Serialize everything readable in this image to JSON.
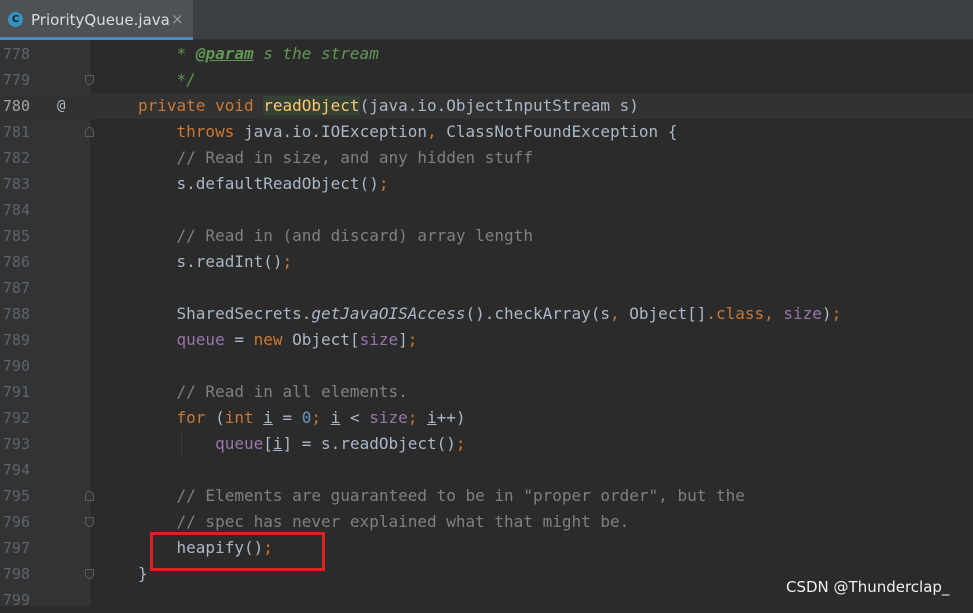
{
  "tab": {
    "label": "PriorityQueue.java",
    "icon": "java-class-icon",
    "close": "×",
    "icon_glyph": "C"
  },
  "gutter": {
    "override_marker": "@"
  },
  "lines": [
    {
      "n": "778",
      "parts": [
        [
          "    ",
          ""
        ],
        [
          "* ",
          "doc"
        ],
        [
          "@param",
          "doctag"
        ],
        [
          " s the stream",
          "doc"
        ]
      ]
    },
    {
      "n": "779",
      "parts": [
        [
          "    ",
          ""
        ],
        [
          "*/",
          "doc"
        ]
      ]
    },
    {
      "n": "780",
      "parts": [
        [
          "private void ",
          "kw"
        ],
        [
          "readObject",
          "fn mhl"
        ],
        [
          "(java.io.ObjectInputStream s)",
          ""
        ]
      ]
    },
    {
      "n": "781",
      "parts": [
        [
          "    ",
          ""
        ],
        [
          "throws ",
          "kw"
        ],
        [
          "java.io.IOException",
          ""
        ],
        [
          ", ",
          "kw"
        ],
        [
          "ClassNotFoundException {",
          ""
        ]
      ]
    },
    {
      "n": "782",
      "parts": [
        [
          "    ",
          ""
        ],
        [
          "// Read in size, and any hidden stuff",
          "cm"
        ]
      ]
    },
    {
      "n": "783",
      "parts": [
        [
          "    s.defaultReadObject()",
          ""
        ],
        [
          ";",
          "kw"
        ]
      ]
    },
    {
      "n": "784",
      "parts": []
    },
    {
      "n": "785",
      "parts": [
        [
          "    ",
          ""
        ],
        [
          "// Read in (and discard) array length",
          "cm"
        ]
      ]
    },
    {
      "n": "786",
      "parts": [
        [
          "    s.readInt()",
          ""
        ],
        [
          ";",
          "kw"
        ]
      ]
    },
    {
      "n": "787",
      "parts": []
    },
    {
      "n": "788",
      "parts": [
        [
          "    SharedSecrets.",
          ""
        ],
        [
          "getJavaOISAccess",
          "it"
        ],
        [
          "().checkArray(s",
          ""
        ],
        [
          ", ",
          "kw"
        ],
        [
          "Object[]",
          ""
        ],
        [
          ".class",
          "kw"
        ],
        [
          ", ",
          "kw"
        ],
        [
          "size",
          "field"
        ],
        [
          ")",
          ""
        ],
        [
          ";",
          "kw"
        ]
      ]
    },
    {
      "n": "789",
      "parts": [
        [
          "    ",
          ""
        ],
        [
          "queue",
          "field"
        ],
        [
          " = ",
          ""
        ],
        [
          "new ",
          "kw"
        ],
        [
          "Object[",
          ""
        ],
        [
          "size",
          "field"
        ],
        [
          "]",
          ""
        ],
        [
          ";",
          "kw"
        ]
      ]
    },
    {
      "n": "790",
      "parts": []
    },
    {
      "n": "791",
      "parts": [
        [
          "    ",
          ""
        ],
        [
          "// Read in all elements.",
          "cm"
        ]
      ]
    },
    {
      "n": "792",
      "parts": [
        [
          "    ",
          ""
        ],
        [
          "for ",
          "kw"
        ],
        [
          "(",
          ""
        ],
        [
          "int ",
          "kw"
        ],
        [
          "i",
          "ul"
        ],
        [
          " = ",
          ""
        ],
        [
          "0",
          "num"
        ],
        [
          "; ",
          "kw"
        ],
        [
          "i",
          "ul"
        ],
        [
          " < ",
          ""
        ],
        [
          "size",
          "field"
        ],
        [
          "; ",
          "kw"
        ],
        [
          "i",
          "ul"
        ],
        [
          "++)",
          ""
        ]
      ]
    },
    {
      "n": "793",
      "parts": [
        [
          "        ",
          ""
        ],
        [
          "queue",
          "field"
        ],
        [
          "[",
          ""
        ],
        [
          "i",
          "ul"
        ],
        [
          "] = s.readObject()",
          ""
        ],
        [
          ";",
          "kw"
        ]
      ]
    },
    {
      "n": "794",
      "parts": []
    },
    {
      "n": "795",
      "parts": [
        [
          "    ",
          ""
        ],
        [
          "// Elements are guaranteed to be in \"proper order\", but the",
          "cm"
        ]
      ]
    },
    {
      "n": "796",
      "parts": [
        [
          "    ",
          ""
        ],
        [
          "// spec has never explained what that might be.",
          "cm"
        ]
      ]
    },
    {
      "n": "797",
      "parts": [
        [
          "    heapify()",
          ""
        ],
        [
          ";",
          "kw"
        ]
      ]
    },
    {
      "n": "798",
      "parts": [
        [
          "}",
          ""
        ]
      ]
    },
    {
      "n": "799",
      "parts": []
    }
  ],
  "watermark": "CSDN @Thunderclap_",
  "colors": {
    "keyword": "#cc7832",
    "comment": "#808080",
    "field": "#9876aa",
    "method": "#ffc66d",
    "number": "#6897bb",
    "javadoc": "#629755",
    "highlight_box": "#e02020"
  }
}
